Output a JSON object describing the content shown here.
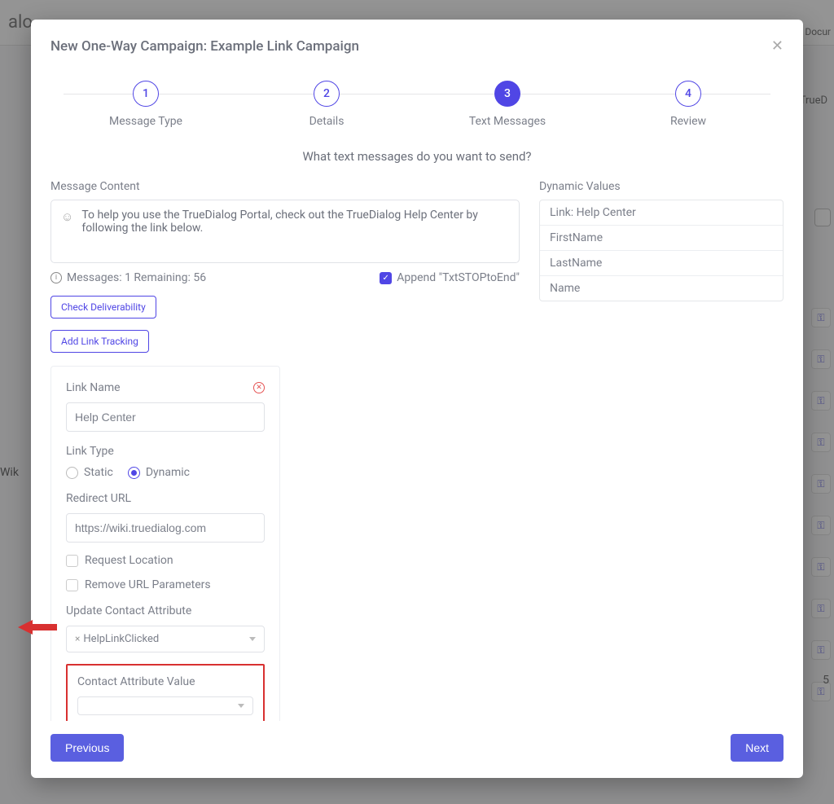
{
  "bg": {
    "brand_partial": "alo",
    "top_right": "Docur",
    "right_text": "TrueD",
    "sidebar_partial": "Wik",
    "bottom_num": "5"
  },
  "modal": {
    "title": "New One-Way Campaign: Example Link Campaign",
    "subtitle": "What text messages do you want to send?"
  },
  "steps": [
    {
      "num": "1",
      "label": "Message Type"
    },
    {
      "num": "2",
      "label": "Details"
    },
    {
      "num": "3",
      "label": "Text Messages"
    },
    {
      "num": "4",
      "label": "Review"
    }
  ],
  "active_step_index": 2,
  "message": {
    "section_label": "Message Content",
    "text": "To help you use the TrueDialog Portal, check out the TrueDialog Help Center by following the link below.",
    "meta": "Messages: 1 Remaining: 56",
    "append_label": "Append \"TxtSTOPtoEnd\""
  },
  "buttons": {
    "check_deliverability": "Check Deliverability",
    "add_link_tracking": "Add Link Tracking",
    "previous": "Previous",
    "next": "Next"
  },
  "link_panel": {
    "link_name_label": "Link Name",
    "link_name_value": "Help Center",
    "link_type_label": "Link Type",
    "static_label": "Static",
    "dynamic_label": "Dynamic",
    "redirect_url_label": "Redirect URL",
    "redirect_url_value": "https://wiki.truedialog.com",
    "request_location": "Request Location",
    "remove_url_params": "Remove URL Parameters",
    "update_attr_label": "Update Contact Attribute",
    "update_attr_value": "HelpLinkClicked",
    "contact_attr_value_label": "Contact Attribute Value"
  },
  "dynamic_values": {
    "label": "Dynamic Values",
    "items": [
      "Link: Help Center",
      "FirstName",
      "LastName",
      "Name"
    ]
  }
}
